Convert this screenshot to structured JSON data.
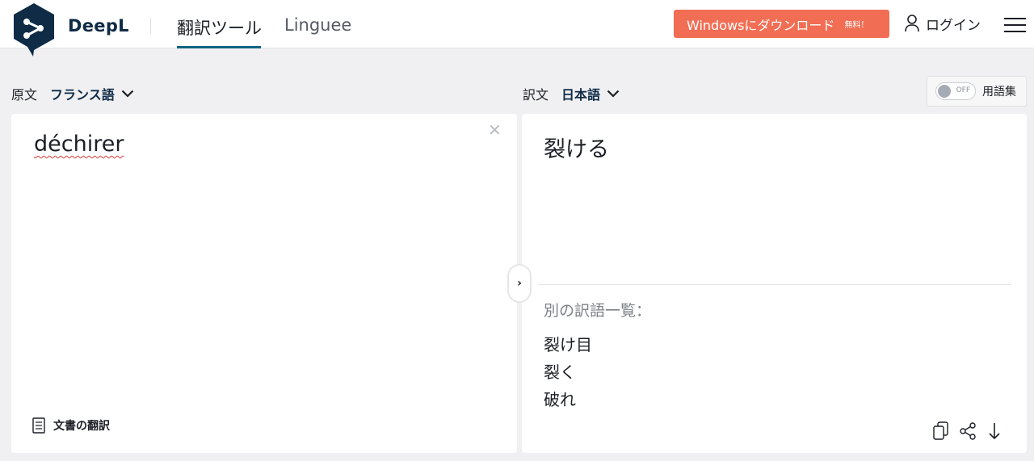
{
  "brand": {
    "name": "DeepL"
  },
  "nav": {
    "tabs": [
      {
        "label": "翻訳ツール",
        "active": true
      },
      {
        "label": "Linguee",
        "active": false
      }
    ]
  },
  "download_button": {
    "label": "Windowsにダウンロード",
    "badge": "無料！"
  },
  "login": {
    "label": "ログイン"
  },
  "source": {
    "label": "原文",
    "language": "フランス語",
    "text": "déchirer",
    "document_button": "文書の翻訳"
  },
  "target": {
    "label": "訳文",
    "language": "日本語",
    "text": "裂ける",
    "alternatives_title": "別の訳語一覧：",
    "alternatives": [
      "裂け目",
      "裂く",
      "破れ"
    ]
  },
  "glossary": {
    "toggle_state": "OFF",
    "label": "用語集"
  },
  "colors": {
    "accent": "#0f6480",
    "brand_dark": "#0f2b46",
    "download": "#f16e54"
  }
}
